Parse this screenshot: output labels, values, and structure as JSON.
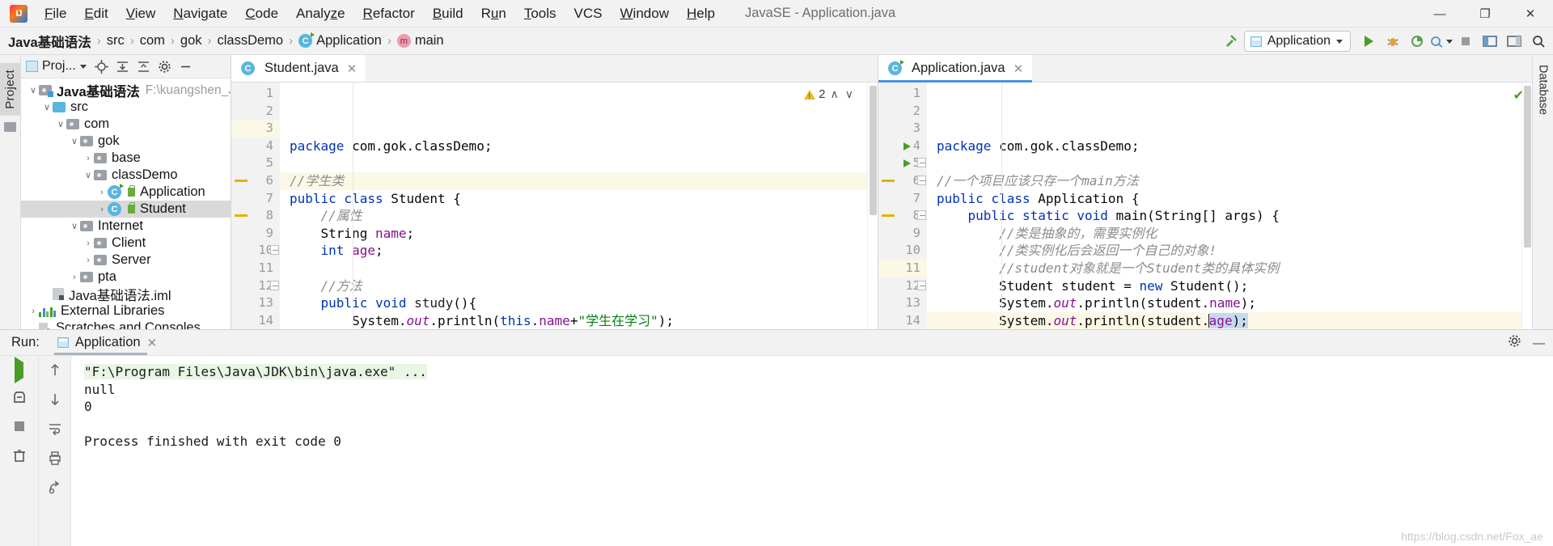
{
  "menu": {
    "logo": "IJ",
    "items": [
      "File",
      "Edit",
      "View",
      "Navigate",
      "Code",
      "Analyze",
      "Refactor",
      "Build",
      "Run",
      "Tools",
      "VCS",
      "Window",
      "Help"
    ],
    "window_title": "JavaSE - Application.java",
    "minimize": "—",
    "maximize": "❐",
    "close": "✕"
  },
  "breadcrumb": {
    "items": [
      "Java基础语法",
      "src",
      "com",
      "gok",
      "classDemo",
      "Application",
      "main"
    ],
    "separator": "›"
  },
  "toolbar": {
    "build_hammer": "build-hammer",
    "run_config": "Application",
    "run": "run",
    "debug": "debug",
    "coverage": "coverage",
    "profile": "profile",
    "stop": "stop",
    "layout": "layout",
    "search": "search"
  },
  "toolwindow_left": {
    "label": "Project"
  },
  "toolwindow_right": {
    "label": "Database"
  },
  "project": {
    "header_title": "Proj...",
    "icons": [
      "locate-icon",
      "expand-all-icon",
      "collapse-all-icon",
      "settings-icon",
      "hide-icon"
    ],
    "tree": [
      {
        "indent": 0,
        "arrow": "v",
        "icon": "module-folder",
        "label": "Java基础语法",
        "bold": true,
        "path": "F:\\kuangshen_Jav"
      },
      {
        "indent": 1,
        "arrow": "v",
        "icon": "source-folder",
        "label": "src"
      },
      {
        "indent": 2,
        "arrow": "v",
        "icon": "package",
        "label": "com"
      },
      {
        "indent": 3,
        "arrow": "v",
        "icon": "package",
        "label": "gok"
      },
      {
        "indent": 4,
        "arrow": ">",
        "icon": "package",
        "label": "base"
      },
      {
        "indent": 4,
        "arrow": "v",
        "icon": "package",
        "label": "classDemo"
      },
      {
        "indent": 5,
        "arrow": ">",
        "icon": "class-runnable",
        "label": "Application"
      },
      {
        "indent": 5,
        "arrow": ">",
        "icon": "class",
        "label": "Student",
        "selected": true
      },
      {
        "indent": 3,
        "arrow": "v",
        "icon": "package",
        "label": "Internet"
      },
      {
        "indent": 4,
        "arrow": ">",
        "icon": "package",
        "label": "Client"
      },
      {
        "indent": 4,
        "arrow": ">",
        "icon": "package",
        "label": "Server"
      },
      {
        "indent": 3,
        "arrow": ">",
        "icon": "package",
        "label": "pta"
      },
      {
        "indent": 1,
        "arrow": "",
        "icon": "iml-file",
        "label": "Java基础语法.iml"
      },
      {
        "indent": 0,
        "arrow": ">",
        "icon": "libraries",
        "label": "External Libraries"
      },
      {
        "indent": 0,
        "arrow": "",
        "icon": "scratches",
        "label": "Scratches and Consoles"
      }
    ]
  },
  "editor_left": {
    "tab": {
      "label": "Student.java",
      "icon": "class-icon",
      "close": "✕"
    },
    "inspection": {
      "warning_count": "2",
      "up": "∧",
      "down": "∨"
    },
    "lines": [
      {
        "n": "1",
        "code": [
          {
            "t": "package ",
            "c": "kw"
          },
          {
            "t": "com.gok.classDemo;",
            "c": "plain"
          }
        ]
      },
      {
        "n": "2",
        "code": []
      },
      {
        "n": "3",
        "hl": true,
        "code": [
          {
            "t": "//学生类",
            "c": "cmt"
          }
        ]
      },
      {
        "n": "4",
        "code": [
          {
            "t": "public class ",
            "c": "kw"
          },
          {
            "t": "Student {",
            "c": "plain"
          }
        ]
      },
      {
        "n": "5",
        "code": [
          {
            "t": "    //属性",
            "c": "cmt"
          }
        ]
      },
      {
        "n": "6",
        "code": [
          {
            "t": "    String ",
            "c": "plain"
          },
          {
            "t": "name",
            "c": "fld"
          },
          {
            "t": ";",
            "c": "plain"
          }
        ],
        "chmark": true
      },
      {
        "n": "7",
        "code": [
          {
            "t": "    ",
            "c": "plain"
          },
          {
            "t": "int ",
            "c": "kw"
          },
          {
            "t": "age",
            "c": "fld"
          },
          {
            "t": ";",
            "c": "plain"
          }
        ]
      },
      {
        "n": "8",
        "code": [],
        "chmark": true
      },
      {
        "n": "9",
        "code": [
          {
            "t": "    //方法",
            "c": "cmt"
          }
        ]
      },
      {
        "n": "10",
        "code": [
          {
            "t": "    ",
            "c": "plain"
          },
          {
            "t": "public void ",
            "c": "kw"
          },
          {
            "t": "study",
            "c": "mth"
          },
          {
            "t": "(){",
            "c": "plain"
          }
        ],
        "fold": true
      },
      {
        "n": "11",
        "code": [
          {
            "t": "        System.",
            "c": "plain"
          },
          {
            "t": "out",
            "c": "stat"
          },
          {
            "t": ".println(",
            "c": "plain"
          },
          {
            "t": "this",
            "c": "kw"
          },
          {
            "t": ".",
            "c": "plain"
          },
          {
            "t": "name",
            "c": "fld"
          },
          {
            "t": "+",
            "c": "plain"
          },
          {
            "t": "\"学生在学习\"",
            "c": "str"
          },
          {
            "t": ");",
            "c": "plain"
          }
        ]
      },
      {
        "n": "12",
        "code": [
          {
            "t": "    }",
            "c": "plain"
          }
        ],
        "fold": true
      },
      {
        "n": "13",
        "code": [
          {
            "t": "}",
            "c": "plain"
          }
        ]
      },
      {
        "n": "14",
        "code": []
      }
    ]
  },
  "editor_right": {
    "tab": {
      "label": "Application.java",
      "icon": "class-runnable-icon",
      "close": "✕"
    },
    "status_ok": "✔",
    "lines": [
      {
        "n": "1",
        "code": [
          {
            "t": "package ",
            "c": "kw"
          },
          {
            "t": "com.gok.classDemo;",
            "c": "plain"
          }
        ]
      },
      {
        "n": "2",
        "code": []
      },
      {
        "n": "3",
        "code": [
          {
            "t": "//一个项目应该只存一个main方法",
            "c": "cmt"
          }
        ]
      },
      {
        "n": "4",
        "code": [
          {
            "t": "public class ",
            "c": "kw"
          },
          {
            "t": "Application {",
            "c": "plain"
          }
        ],
        "run": true
      },
      {
        "n": "5",
        "code": [
          {
            "t": "    ",
            "c": "plain"
          },
          {
            "t": "public static void ",
            "c": "kw"
          },
          {
            "t": "main(String[] args) {",
            "c": "plain"
          }
        ],
        "run": true,
        "fold": true
      },
      {
        "n": "6",
        "code": [
          {
            "t": "        //类是抽象的，需要实例化",
            "c": "cmt"
          }
        ],
        "fold": true,
        "chmark": true
      },
      {
        "n": "7",
        "code": [
          {
            "t": "        //类实例化后会返回一个自己的对象!",
            "c": "cmt"
          }
        ]
      },
      {
        "n": "8",
        "code": [
          {
            "t": "        //student对象就是一个Student类的具体实例",
            "c": "cmt"
          }
        ],
        "fold": true,
        "chmark": true
      },
      {
        "n": "9",
        "code": [
          {
            "t": "        Student student = ",
            "c": "plain"
          },
          {
            "t": "new ",
            "c": "kw"
          },
          {
            "t": "Student();",
            "c": "plain"
          }
        ]
      },
      {
        "n": "10",
        "code": [
          {
            "t": "        System.",
            "c": "plain"
          },
          {
            "t": "out",
            "c": "stat"
          },
          {
            "t": ".println(student.",
            "c": "plain"
          },
          {
            "t": "name",
            "c": "fld"
          },
          {
            "t": ");",
            "c": "plain"
          }
        ]
      },
      {
        "n": "11",
        "hl": true,
        "code": [
          {
            "t": "        System.",
            "c": "plain"
          },
          {
            "t": "out",
            "c": "stat"
          },
          {
            "t": ".println(student.",
            "c": "plain"
          },
          {
            "t": "age",
            "c": "fld"
          },
          {
            "t": ");",
            "c": "plain"
          }
        ]
      },
      {
        "n": "12",
        "code": [
          {
            "t": "    }",
            "c": "plain"
          }
        ],
        "fold": true
      },
      {
        "n": "13",
        "code": [
          {
            "t": "}",
            "c": "plain"
          }
        ]
      },
      {
        "n": "14",
        "code": []
      }
    ]
  },
  "run_panel": {
    "label": "Run:",
    "tab_label": "Application",
    "tab_close": "✕",
    "settings_icon": "gear-icon",
    "minimize_icon": "—",
    "tools": [
      "rerun-icon",
      "stop-icon",
      "trash-icon"
    ],
    "nav": [
      "scroll-up-icon",
      "scroll-down-icon",
      "soft-wrap-icon",
      "print-icon",
      "export-icon"
    ],
    "console": [
      {
        "text": "\"F:\\Program Files\\Java\\JDK\\bin\\java.exe\" ...",
        "highlight": true
      },
      {
        "text": "null"
      },
      {
        "text": "0"
      },
      {
        "text": ""
      },
      {
        "text": "Process finished with exit code 0"
      }
    ],
    "watermark": "https://blog.csdn.net/Fox_ae"
  }
}
